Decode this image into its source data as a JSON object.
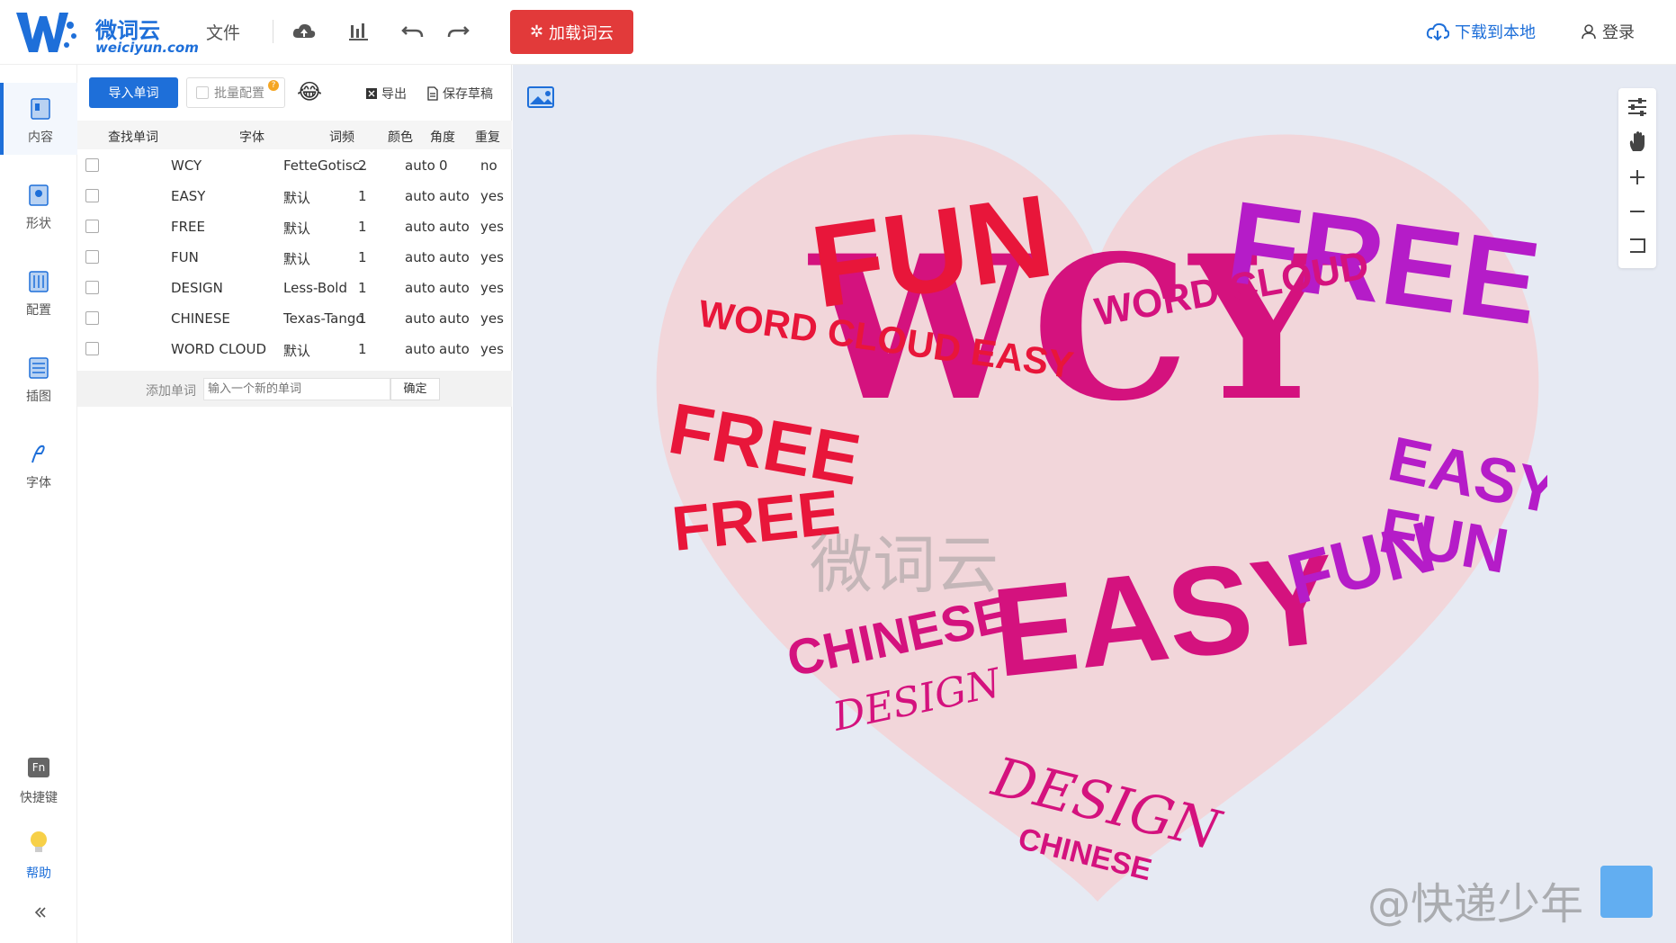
{
  "header": {
    "logo_cn": "微词云",
    "logo_en": "weiciyun.com",
    "file_menu": "文件",
    "load_cloud": "加载词云",
    "download": "下载到本地",
    "login": "登录"
  },
  "nav": {
    "items": [
      {
        "label": "内容",
        "icon": "content-icon"
      },
      {
        "label": "形状",
        "icon": "shape-icon"
      },
      {
        "label": "配置",
        "icon": "config-icon"
      },
      {
        "label": "插图",
        "icon": "illustration-icon"
      },
      {
        "label": "字体",
        "icon": "font-icon"
      }
    ],
    "shortcuts": "快捷键",
    "help": "帮助"
  },
  "panel": {
    "import_words": "导入单词",
    "batch_config": "批量配置",
    "export": "导出",
    "save_draft": "保存草稿",
    "columns": [
      "查找单词",
      "字体",
      "词频",
      "颜色",
      "角度",
      "重复"
    ],
    "rows": [
      {
        "word": "WCY",
        "font": "FetteGotisc...",
        "freq": "2",
        "color": "auto",
        "angle": "0",
        "repeat": "no"
      },
      {
        "word": "EASY",
        "font": "默认",
        "freq": "1",
        "color": "auto",
        "angle": "auto",
        "repeat": "yes"
      },
      {
        "word": "FREE",
        "font": "默认",
        "freq": "1",
        "color": "auto",
        "angle": "auto",
        "repeat": "yes"
      },
      {
        "word": "FUN",
        "font": "默认",
        "freq": "1",
        "color": "auto",
        "angle": "auto",
        "repeat": "yes"
      },
      {
        "word": "DESIGN",
        "font": "Less-Bold",
        "freq": "1",
        "color": "auto",
        "angle": "auto",
        "repeat": "yes"
      },
      {
        "word": "CHINESE",
        "font": "Texas-Tango",
        "freq": "1",
        "color": "auto",
        "angle": "auto",
        "repeat": "yes"
      },
      {
        "word": "WORD CLOUD",
        "font": "默认",
        "freq": "1",
        "color": "auto",
        "angle": "auto",
        "repeat": "yes"
      }
    ],
    "add_word_label": "添加单词",
    "add_word_placeholder": "输入一个新的单词",
    "confirm": "确定"
  },
  "canvas": {
    "watermark_big": "微词云",
    "social_watermark": "@快递少年",
    "words": [
      "WCY",
      "FREE",
      "FUN",
      "EASY",
      "CHINESE",
      "DESIGN",
      "WORD CLOUD"
    ],
    "colors": {
      "red": "#e8163a",
      "magenta": "#d4127e",
      "purple": "#b51cc8",
      "heart": "#f2d6da"
    }
  }
}
